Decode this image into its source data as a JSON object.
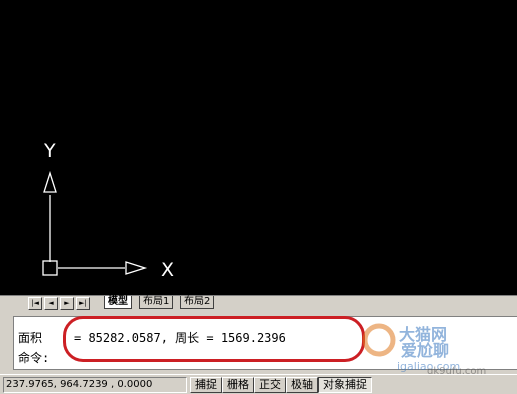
{
  "ucs": {
    "x_label": "X",
    "y_label": "Y"
  },
  "layout_tabs": {
    "nav": [
      "|◄",
      "◄",
      "►",
      "►|"
    ],
    "tabs": [
      {
        "label": "模型",
        "active": true
      },
      {
        "label": "布局1",
        "active": false
      },
      {
        "label": "布局2",
        "active": false
      }
    ]
  },
  "command": {
    "label_area": "面积",
    "result": "= 85282.0587, 周长 = 1569.2396",
    "prompt": "命令:"
  },
  "watermark": {
    "text1": "大猫网",
    "text2": "爱尬聊",
    "url": "igaliao.com",
    "url2": "qk9ufu.com"
  },
  "statusbar": {
    "coordinates": "237.9765,  964.7239 , 0.0000",
    "toggles": [
      {
        "label": "捕捉",
        "pressed": false
      },
      {
        "label": "栅格",
        "pressed": false
      },
      {
        "label": "正交",
        "pressed": false
      },
      {
        "label": "极轴",
        "pressed": false
      },
      {
        "label": "对象捕捉",
        "pressed": true
      }
    ]
  },
  "colors": {
    "canvas": "#000000",
    "ucs_icon": "#ffffff",
    "highlight": "#cc1f24"
  }
}
